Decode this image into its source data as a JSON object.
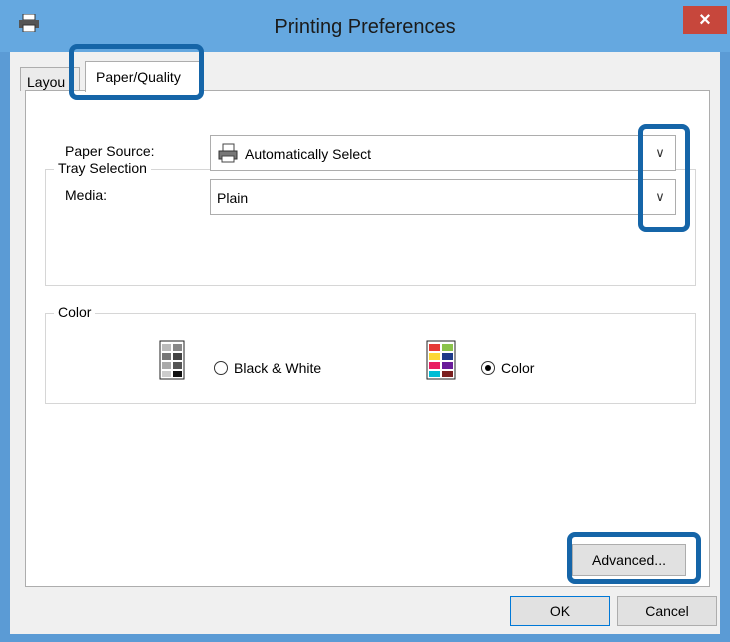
{
  "window": {
    "title": "Printing Preferences",
    "close_glyph": "×",
    "icon": "printer-icon"
  },
  "tabs": [
    {
      "label": "Layout",
      "visible_label": "Layou",
      "selected": false
    },
    {
      "label": "Paper/Quality",
      "selected": true
    }
  ],
  "tray_selection": {
    "title": "Tray Selection",
    "paper_source_label": "Paper Source:",
    "paper_source_value": "Automatically Select",
    "media_label": "Media:",
    "media_value": "Plain"
  },
  "color_group": {
    "title": "Color",
    "options": [
      {
        "label": "Black & White",
        "checked": false
      },
      {
        "label": "Color",
        "checked": true
      }
    ]
  },
  "buttons": {
    "advanced": "Advanced...",
    "ok": "OK",
    "cancel": "Cancel"
  },
  "colors": {
    "title_bar": "#65a8e0",
    "close_button": "#c7473c",
    "highlight": "#1565a8"
  }
}
